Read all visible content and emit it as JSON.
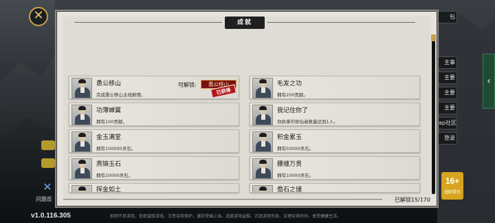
{
  "app": {
    "version": "v1.0.116.305"
  },
  "panel": {
    "title": "成就",
    "unlocked_count": "已解锁15/170"
  },
  "achievements": [
    {
      "name": "愚公移山",
      "desc": "完成愚公移山主线剧情。",
      "unlock_label": "可解锁:",
      "unlock_item": "愚公移山",
      "stamp": "已获得"
    },
    {
      "name": "毛发之功",
      "desc": "拥有200贡献。"
    },
    {
      "name": "功薄蝉翼",
      "desc": "拥有100贡献。"
    },
    {
      "name": "我记住你了",
      "desc": "你执掌的修仙者数量达到1人。"
    },
    {
      "name": "金玉满堂",
      "desc": "拥有100000灵石。"
    },
    {
      "name": "积金累玉",
      "desc": "拥有50000灵石。"
    },
    {
      "name": "燕锦玉石",
      "desc": "拥有20000灵石。"
    },
    {
      "name": "腰缠万贯",
      "desc": "拥有10000灵石。"
    },
    {
      "name": "挥金如土",
      "desc": ""
    },
    {
      "name": "儋石之储",
      "desc": ""
    }
  ],
  "side_menu": [
    "包",
    "",
    "主事",
    "主要",
    "主要",
    "主要",
    "ap社区",
    "登录"
  ],
  "left_tags": [
    "",
    ""
  ],
  "left_icon_label": "问题反",
  "age_badge": {
    "value": "16+",
    "sub": "适龄提示"
  },
  "disclaimer": "抵制不良游戏，拒绝盗版游戏。注意自我保护，谨防受骗上当。适度游戏益脑，沉迷游戏伤身。合理安排时间，享受健康生活。"
}
